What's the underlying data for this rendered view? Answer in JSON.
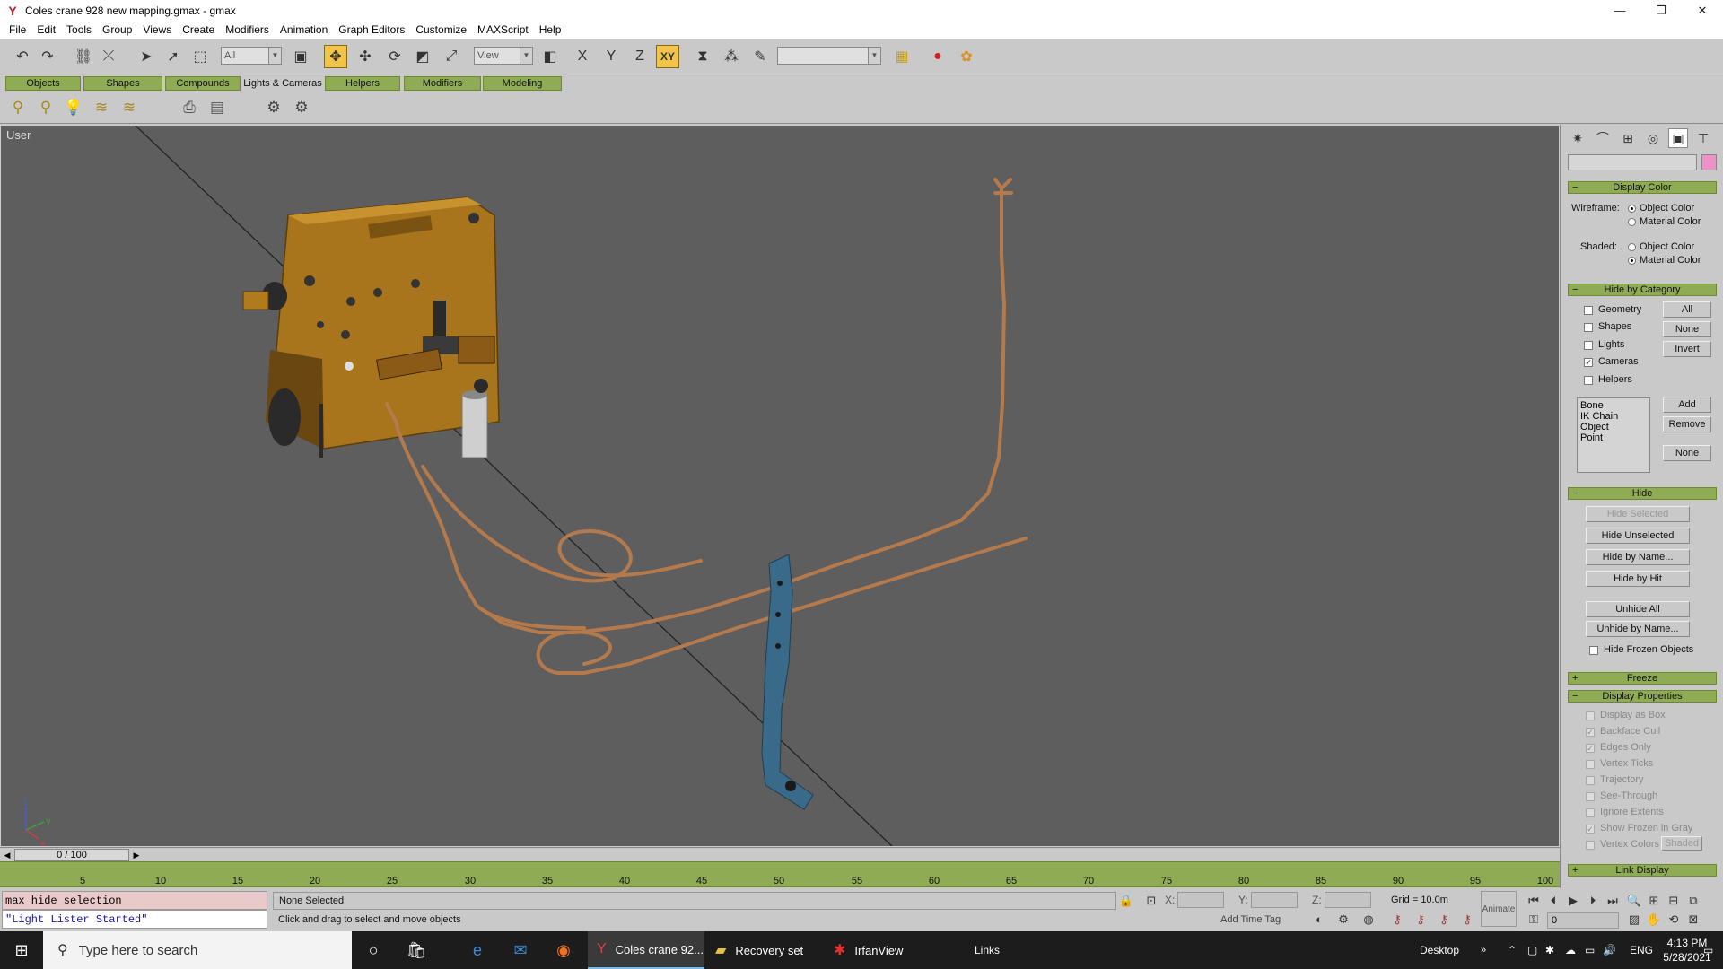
{
  "window": {
    "title": "Coles crane 928 new mapping.gmax - gmax",
    "minimize": "—",
    "restore": "❐",
    "close": "✕"
  },
  "menu": [
    "File",
    "Edit",
    "Tools",
    "Group",
    "Views",
    "Create",
    "Modifiers",
    "Animation",
    "Graph Editors",
    "Customize",
    "MAXScript",
    "Help"
  ],
  "toolbar": {
    "selection_filter": "All",
    "ref_coord": "View",
    "axis_x": "X",
    "axis_y": "Y",
    "axis_z": "Z",
    "axis_xy": "XY",
    "named_selection": ""
  },
  "tabs": [
    "Objects",
    "Shapes",
    "Compounds",
    "Lights & Cameras",
    "Helpers",
    "Modifiers",
    "Modeling"
  ],
  "active_tab": "Lights & Cameras",
  "viewport": {
    "label": "User"
  },
  "command_panel": {
    "display_color": {
      "title": "Display Color",
      "wireframe_label": "Wireframe:",
      "shaded_label": "Shaded:",
      "object_color": "Object Color",
      "material_color": "Material Color"
    },
    "hide_by_category": {
      "title": "Hide by Category",
      "items": [
        {
          "label": "Geometry",
          "checked": false
        },
        {
          "label": "Shapes",
          "checked": false
        },
        {
          "label": "Lights",
          "checked": false
        },
        {
          "label": "Cameras",
          "checked": true
        },
        {
          "label": "Helpers",
          "checked": false
        }
      ],
      "btn_all": "All",
      "btn_none": "None",
      "btn_invert": "Invert",
      "list": [
        "Bone",
        "IK Chain Object",
        "Point"
      ],
      "btn_add": "Add",
      "btn_remove": "Remove",
      "btn_none2": "None"
    },
    "hide": {
      "title": "Hide",
      "hide_selected": "Hide Selected",
      "hide_unselected": "Hide Unselected",
      "hide_by_name": "Hide by Name...",
      "hide_by_hit": "Hide by Hit",
      "unhide_all": "Unhide All",
      "unhide_by_name": "Unhide by Name...",
      "hide_frozen": "Hide Frozen Objects"
    },
    "freeze": {
      "title": "Freeze"
    },
    "display_properties": {
      "title": "Display Properties",
      "items": [
        {
          "label": "Display as Box",
          "checked": false
        },
        {
          "label": "Backface Cull",
          "checked": true
        },
        {
          "label": "Edges Only",
          "checked": true
        },
        {
          "label": "Vertex Ticks",
          "checked": false
        },
        {
          "label": "Trajectory",
          "checked": false
        },
        {
          "label": "See-Through",
          "checked": false
        },
        {
          "label": "Ignore Extents",
          "checked": false
        },
        {
          "label": "Show Frozen in Gray",
          "checked": true
        },
        {
          "label": "Vertex Colors",
          "checked": false
        }
      ],
      "shaded_btn": "Shaded"
    },
    "link_display": {
      "title": "Link Display"
    }
  },
  "timeline": {
    "frame_display": "0 / 100",
    "ticks": [
      "5",
      "10",
      "15",
      "20",
      "25",
      "30",
      "35",
      "40",
      "45",
      "50",
      "55",
      "60",
      "65",
      "70",
      "75",
      "80",
      "85",
      "90",
      "95",
      "100"
    ]
  },
  "status": {
    "listener_input": "max hide selection",
    "listener_output": "\"Light Lister Started\"",
    "selection": "None Selected",
    "prompt": "Click and drag to select and move objects",
    "x_label": "X:",
    "y_label": "Y:",
    "z_label": "Z:",
    "grid": "Grid = 10.0m",
    "add_time_tag": "Add Time Tag",
    "animate": "Animate",
    "frame": "0"
  },
  "taskbar": {
    "search_placeholder": "Type here to search",
    "apps": [
      {
        "label": "Coles crane 92...",
        "icon": "gmax-icon",
        "active": true
      },
      {
        "label": "Recovery set",
        "icon": "folder-icon",
        "active": false
      },
      {
        "label": "IrfanView",
        "icon": "irfanview-icon",
        "active": false
      }
    ],
    "links": "Links",
    "desktop": "Desktop",
    "language": "ENG",
    "time": "4:13 PM",
    "date": "5/28/2021"
  },
  "colors": {
    "accent_green": "#8fac54",
    "viewport_bg": "#5e5e5e",
    "engine_body": "#b07a1e",
    "pipe": "#b47a4c",
    "bracket": "#3a6a8a",
    "active_tool": "#f3c44a"
  }
}
